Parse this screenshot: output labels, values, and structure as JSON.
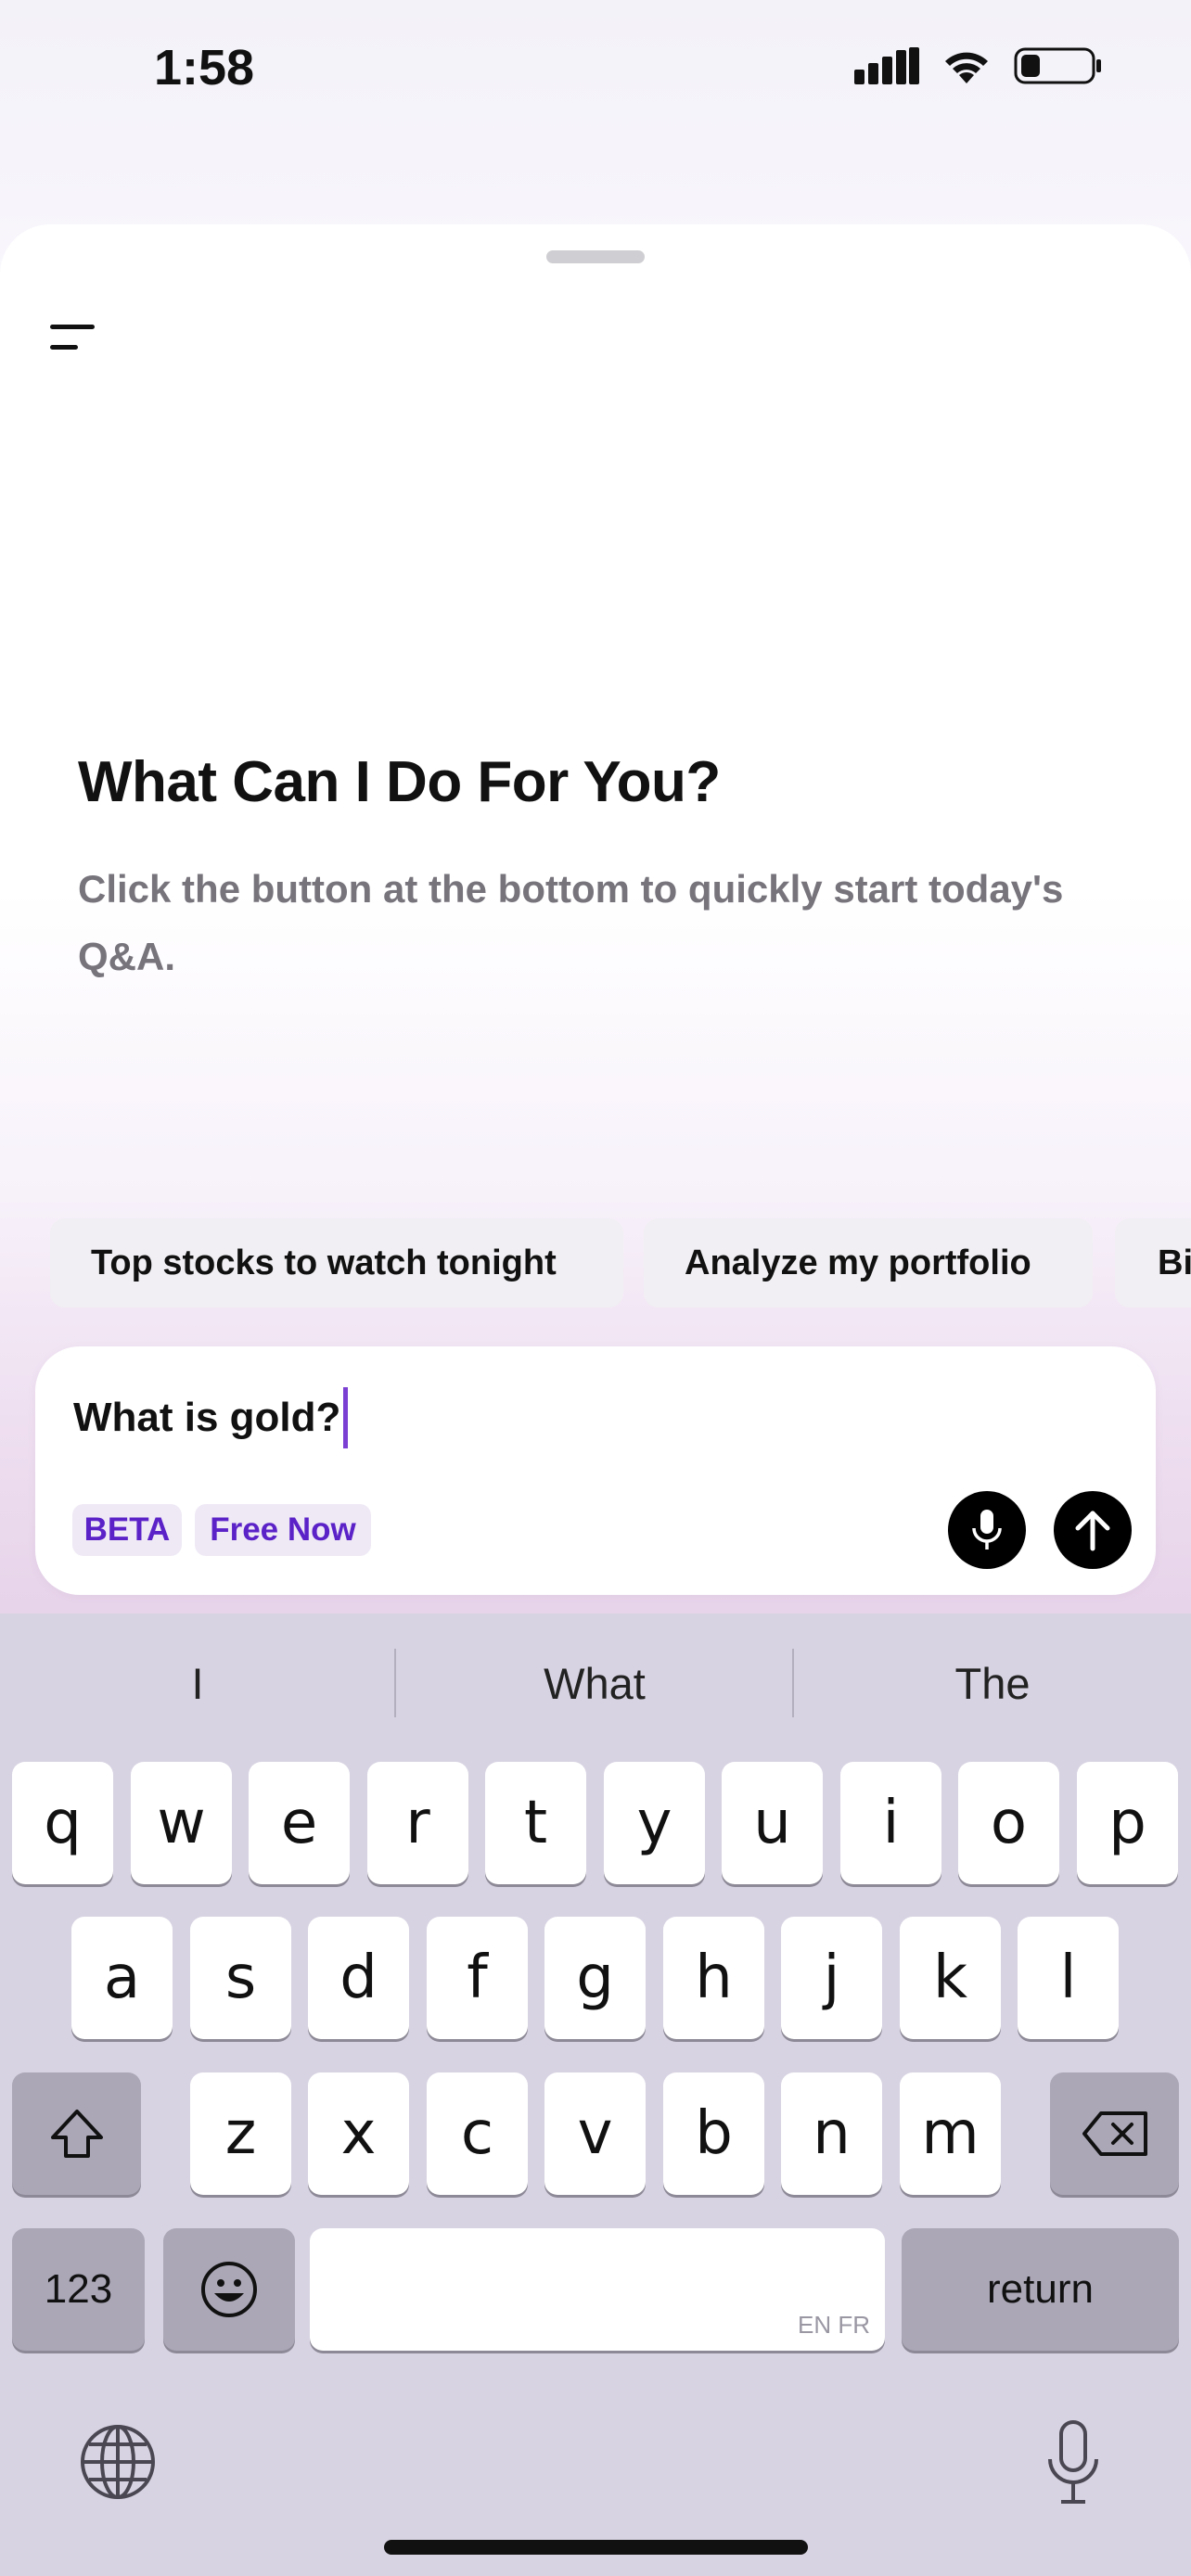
{
  "status_bar": {
    "time": "1:58"
  },
  "main": {
    "heading": "What Can I Do For You?",
    "subtitle": "Click the button at the bottom to quickly start today's Q&A."
  },
  "suggestion_chips": [
    "Top stocks to watch tonight",
    "Analyze my portfolio",
    "Bi"
  ],
  "composer": {
    "input_value": "What is gold?",
    "badge_beta": "BETA",
    "badge_free": "Free Now"
  },
  "keyboard": {
    "predictions": [
      "I",
      "What",
      "The"
    ],
    "row1": [
      "q",
      "w",
      "e",
      "r",
      "t",
      "y",
      "u",
      "i",
      "o",
      "p"
    ],
    "row2": [
      "a",
      "s",
      "d",
      "f",
      "g",
      "h",
      "j",
      "k",
      "l"
    ],
    "row3": [
      "z",
      "x",
      "c",
      "v",
      "b",
      "n",
      "m"
    ],
    "numbers_key": "123",
    "return_key": "return",
    "space_languages": "EN FR"
  },
  "colors": {
    "accent": "#7b3fd3",
    "badge_text": "#5b22c8",
    "keyboard_bg": "#d8d3e2"
  }
}
